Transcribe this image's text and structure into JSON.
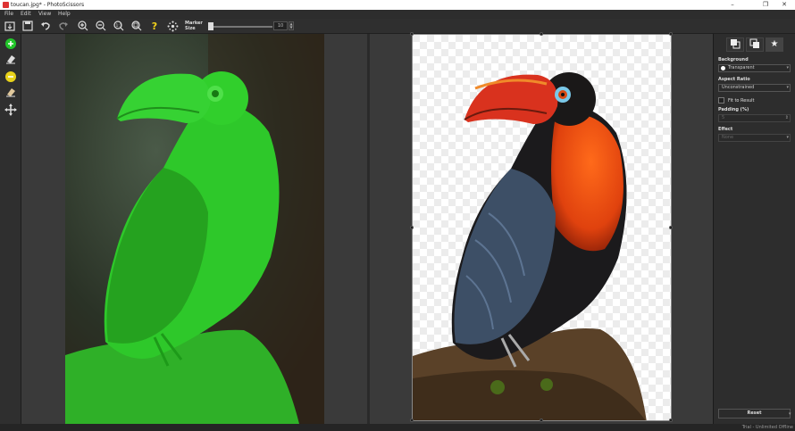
{
  "window": {
    "title": "toucan.jpg* - PhotoScissors",
    "minimize": "–",
    "maximize": "❐",
    "close": "✕"
  },
  "menu": [
    "File",
    "Edit",
    "View",
    "Help"
  ],
  "toolbar": {
    "marker_label_1": "Marker",
    "marker_label_2": "Size",
    "marker_size": "10",
    "marker_level": 0.04,
    "icons": [
      "open-icon",
      "save-icon",
      "undo-icon",
      "redo-icon",
      "zoom-in-icon",
      "zoom-out-icon",
      "zoom-actual-icon",
      "zoom-fit-icon",
      "help-icon",
      "drag-icon"
    ]
  },
  "panel": {
    "background_label": "Background",
    "background_value": "Transparent",
    "aspect_label": "Aspect Ratio",
    "aspect_value": "Unconstrained",
    "fit_label": "Fit to Result",
    "padding_label": "Padding (%)",
    "padding_value": "5",
    "effect_label": "Effect",
    "effect_value": "None",
    "reset_label": "Reset"
  },
  "status": "Trial - Unlimited Offline",
  "colors": {
    "foreground_marker": "#22c52a",
    "background_marker": "#e8d21a",
    "accent": "#2b2b2b"
  }
}
